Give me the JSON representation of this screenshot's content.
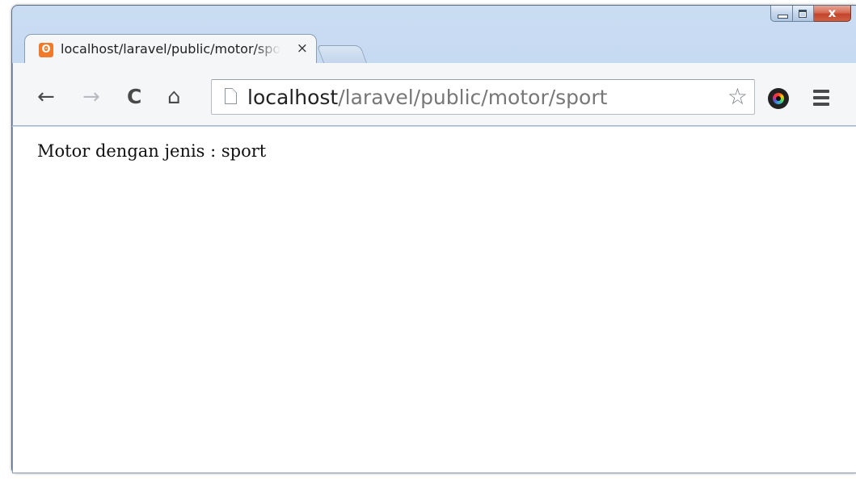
{
  "window": {
    "caption": {
      "minimize_icon": "minimize-icon",
      "maximize_icon": "maximize-icon",
      "close_label": "x"
    }
  },
  "tab": {
    "favicon": "xampp-icon",
    "title": "localhost/laravel/public/motor/sport",
    "close_label": "×"
  },
  "toolbar": {
    "back_label": "←",
    "forward_label": "→",
    "reload_label": "C",
    "home_label": "⌂",
    "address": {
      "host": "localhost",
      "path": "/laravel/public/motor/sport"
    },
    "bookmark_star": "☆"
  },
  "page": {
    "body_text": "Motor dengan jenis : sport"
  },
  "colors": {
    "frame": "#b9d2ee",
    "close_button": "#c2452b",
    "favicon": "#f07a2a"
  }
}
